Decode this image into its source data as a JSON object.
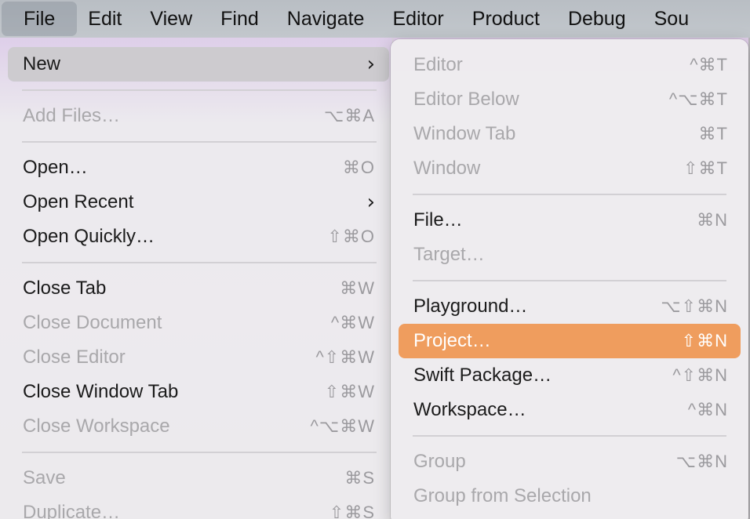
{
  "menubar": {
    "items": [
      {
        "label": "File",
        "active": true
      },
      {
        "label": "Edit"
      },
      {
        "label": "View"
      },
      {
        "label": "Find"
      },
      {
        "label": "Navigate"
      },
      {
        "label": "Editor"
      },
      {
        "label": "Product"
      },
      {
        "label": "Debug"
      },
      {
        "label": "Sou"
      }
    ]
  },
  "file_menu": {
    "items": [
      {
        "label": "New",
        "shortcut": "",
        "submenu": true,
        "highlighted": true
      },
      {
        "label": "Add Files…",
        "shortcut": "⌥⌘A",
        "disabled": true
      },
      {
        "label": "Open…",
        "shortcut": "⌘O"
      },
      {
        "label": "Open Recent",
        "shortcut": "",
        "submenu": true
      },
      {
        "label": "Open Quickly…",
        "shortcut": "⇧⌘O"
      },
      {
        "label": "Close Tab",
        "shortcut": "⌘W"
      },
      {
        "label": "Close Document",
        "shortcut": "^⌘W",
        "disabled": true
      },
      {
        "label": "Close Editor",
        "shortcut": "^⇧⌘W",
        "disabled": true
      },
      {
        "label": "Close Window Tab",
        "shortcut": "⇧⌘W"
      },
      {
        "label": "Close Workspace",
        "shortcut": "^⌥⌘W",
        "disabled": true
      },
      {
        "label": "Save",
        "shortcut": "⌘S",
        "disabled": true
      },
      {
        "label": "Duplicate…",
        "shortcut": "⇧⌘S",
        "disabled": true
      }
    ],
    "chevron": "›"
  },
  "new_submenu": {
    "items": [
      {
        "label": "Editor",
        "shortcut": "^⌘T",
        "disabled": true
      },
      {
        "label": "Editor Below",
        "shortcut": "^⌥⌘T",
        "disabled": true
      },
      {
        "label": "Window Tab",
        "shortcut": "⌘T",
        "disabled": true
      },
      {
        "label": "Window",
        "shortcut": "⇧⌘T",
        "disabled": true
      },
      {
        "label": "File…",
        "shortcut": "⌘N"
      },
      {
        "label": "Target…",
        "shortcut": "",
        "disabled": true
      },
      {
        "label": "Playground…",
        "shortcut": "⌥⇧⌘N"
      },
      {
        "label": "Project…",
        "shortcut": "⇧⌘N",
        "selected": true
      },
      {
        "label": "Swift Package…",
        "shortcut": "^⇧⌘N"
      },
      {
        "label": "Workspace…",
        "shortcut": "^⌘N"
      },
      {
        "label": "Group",
        "shortcut": "⌥⌘N",
        "disabled": true
      },
      {
        "label": "Group from Selection",
        "shortcut": "",
        "disabled": true
      }
    ]
  },
  "colors": {
    "selection_accent": "#ef9d5e",
    "hover": "#cdcbcf",
    "disabled_text": "#a9a8ab"
  }
}
